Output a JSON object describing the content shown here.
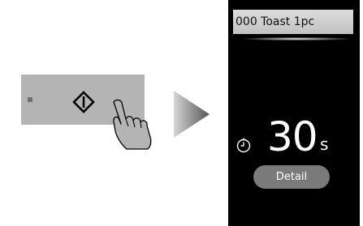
{
  "control_panel": {
    "start_button_icon": "start-diamond-icon",
    "indicator_icon": "indicator-dot-icon",
    "pointer_icon": "tapping-hand-icon"
  },
  "transition_icon": "right-triangle-arrow-icon",
  "display": {
    "program_label": "000 Toast 1pc",
    "timer_icon": "clock-icon",
    "time_value": "30",
    "time_unit": "s",
    "detail_button_label": "Detail"
  },
  "colors": {
    "panel": "#b4b4b4",
    "screen": "#000000",
    "detail_button": "#7a7a7a",
    "program_bar": "#cfcfcf"
  }
}
